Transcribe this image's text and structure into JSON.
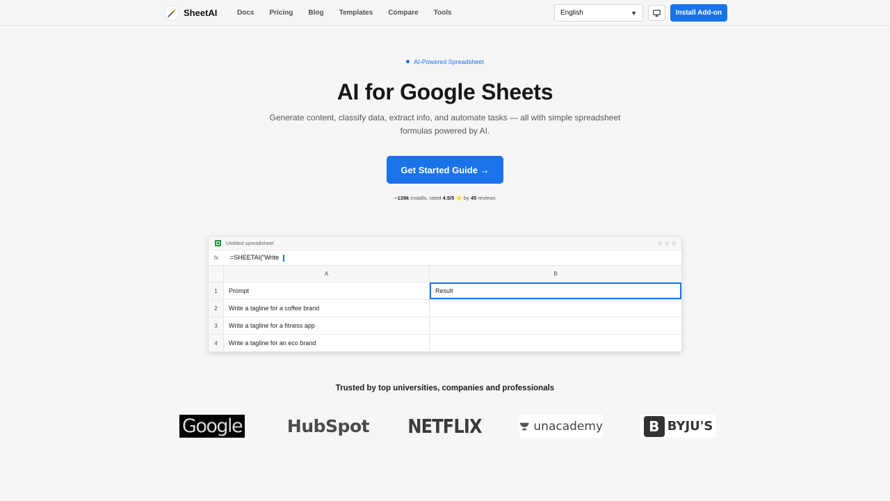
{
  "nav": {
    "brand": "SheetAI",
    "links": [
      "Docs",
      "Pricing",
      "Blog",
      "Templates",
      "Compare",
      "Tools"
    ],
    "language": "English",
    "install_label": "Install Add-on"
  },
  "hero": {
    "badge": "AI-Powered Spreadsheet",
    "title": "AI for Google Sheets",
    "subtitle": "Generate content, classify data, extract info, and automate tasks — all with simple spreadsheet formulas powered by AI.",
    "cta_label": "Get Started Guide →",
    "stats": {
      "installs": "~139k",
      "installs_suffix": "installs, rated",
      "rating": "4.5/5",
      "star": "⭐",
      "by": "by",
      "reviews_count": "45",
      "reviews_suffix": "reviews"
    }
  },
  "sheet": {
    "title": "Untitled spreadsheet",
    "fx_label": "fx",
    "formula": "=SHEETAI(\"Write",
    "col_a": "A",
    "col_b": "B",
    "rows": [
      {
        "num": "1",
        "a": "Prompt",
        "b": "Result"
      },
      {
        "num": "2",
        "a": "Write a tagline for a coffee brand",
        "b": ""
      },
      {
        "num": "3",
        "a": "Write a tagline for a fitness app",
        "b": ""
      },
      {
        "num": "4",
        "a": "Write a tagline for an eco brand",
        "b": ""
      }
    ]
  },
  "trust": {
    "heading": "Trusted by top universities, companies and professionals",
    "logos": [
      "Google",
      "HubSpot",
      "NETFLIX",
      "unacademy",
      "BYJU'S"
    ],
    "byjus_mark": "B"
  },
  "colors": {
    "accent": "#1a73e8",
    "background": "#f6f6f6",
    "sheets_green": "#1e8e3e"
  },
  "icons": {
    "brand": "magic-wand-icon",
    "monitor": "monitor-icon",
    "dropdown": "chevron-down-icon",
    "sheets": "google-sheets-icon"
  }
}
